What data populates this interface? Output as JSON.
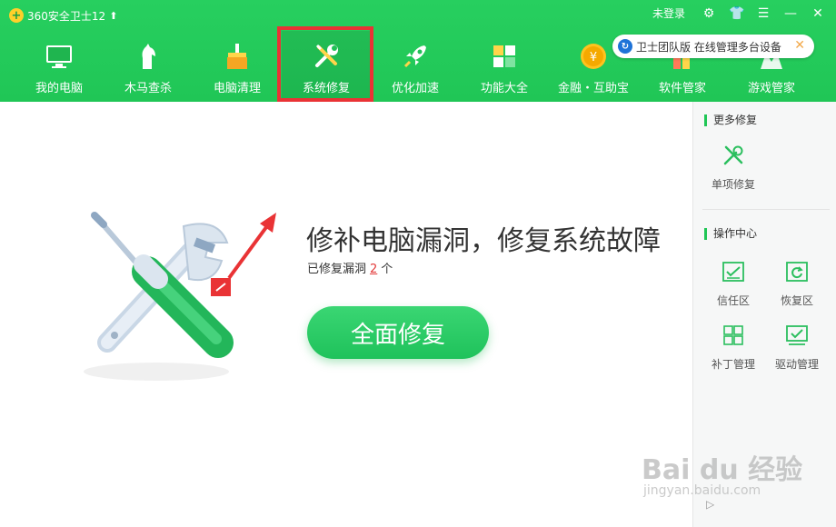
{
  "app": {
    "title": "360安全卫士12"
  },
  "window": {
    "login": "未登录"
  },
  "nav": [
    {
      "label": "我的电脑",
      "icon": "monitor-icon"
    },
    {
      "label": "木马查杀",
      "icon": "horse-icon"
    },
    {
      "label": "电脑清理",
      "icon": "broom-icon"
    },
    {
      "label": "系统修复",
      "icon": "wrench-screwdriver-icon",
      "active": true
    },
    {
      "label": "优化加速",
      "icon": "rocket-icon"
    },
    {
      "label": "功能大全",
      "icon": "grid-icon"
    },
    {
      "label": "金融・互助宝",
      "icon": "coin-icon"
    },
    {
      "label": "软件管家",
      "icon": "software-icon"
    },
    {
      "label": "游戏管家",
      "icon": "game-icon"
    }
  ],
  "notice": {
    "text": "卫士团队版 在线管理多台设备"
  },
  "main": {
    "title": "修补电脑漏洞，修复系统故障",
    "sub_prefix": "已修复漏洞",
    "fixed_count": "2",
    "sub_suffix": "个",
    "button": "全面修复"
  },
  "sidebar": {
    "more_title": "更多修复",
    "single_repair": "单项修复",
    "ops_title": "操作中心",
    "trust_zone": "信任区",
    "restore_zone": "恢复区",
    "patch_manage": "补丁管理",
    "driver_manage": "驱动管理"
  },
  "watermark": {
    "line1": "Bai du 经验",
    "line2": "jingyan.baidu.com"
  },
  "colors": {
    "brand": "#20c656",
    "highlight": "#e93335",
    "count": "#e23a3a"
  }
}
